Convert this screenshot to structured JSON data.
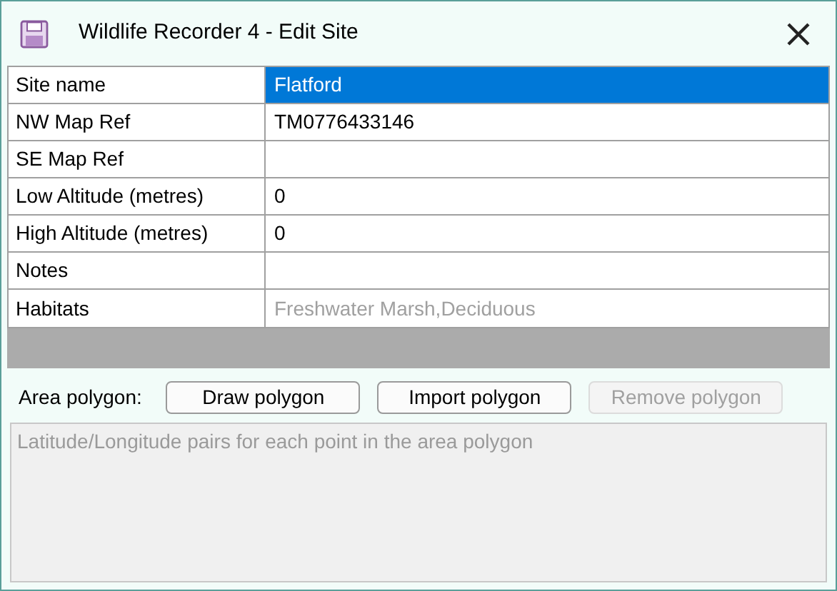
{
  "window": {
    "title": "Wildlife Recorder 4 - Edit Site"
  },
  "fields": [
    {
      "label": "Site name",
      "value": "Flatford",
      "selected": true
    },
    {
      "label": "NW Map Ref",
      "value": "TM0776433146",
      "selected": false
    },
    {
      "label": "SE Map Ref",
      "selected": false
    },
    {
      "label": "Low Altitude (metres)",
      "value": "0",
      "selected": false
    },
    {
      "label": "High Altitude (metres)",
      "value": "0",
      "selected": false
    },
    {
      "label": "Notes",
      "selected": false
    },
    {
      "label": "Habitats",
      "value": "Freshwater Marsh,Deciduous",
      "selected": false,
      "disabled": true
    }
  ],
  "area_polygon": {
    "label": "Area polygon:",
    "buttons": [
      {
        "label": "Draw polygon",
        "disabled": false
      },
      {
        "label": "Import polygon",
        "disabled": false
      },
      {
        "label": "Remove polygon",
        "disabled": true
      }
    ],
    "points": {
      "placeholder": "Latitude/Longitude pairs for each point in the area polygon",
      "disabled": true
    }
  }
}
